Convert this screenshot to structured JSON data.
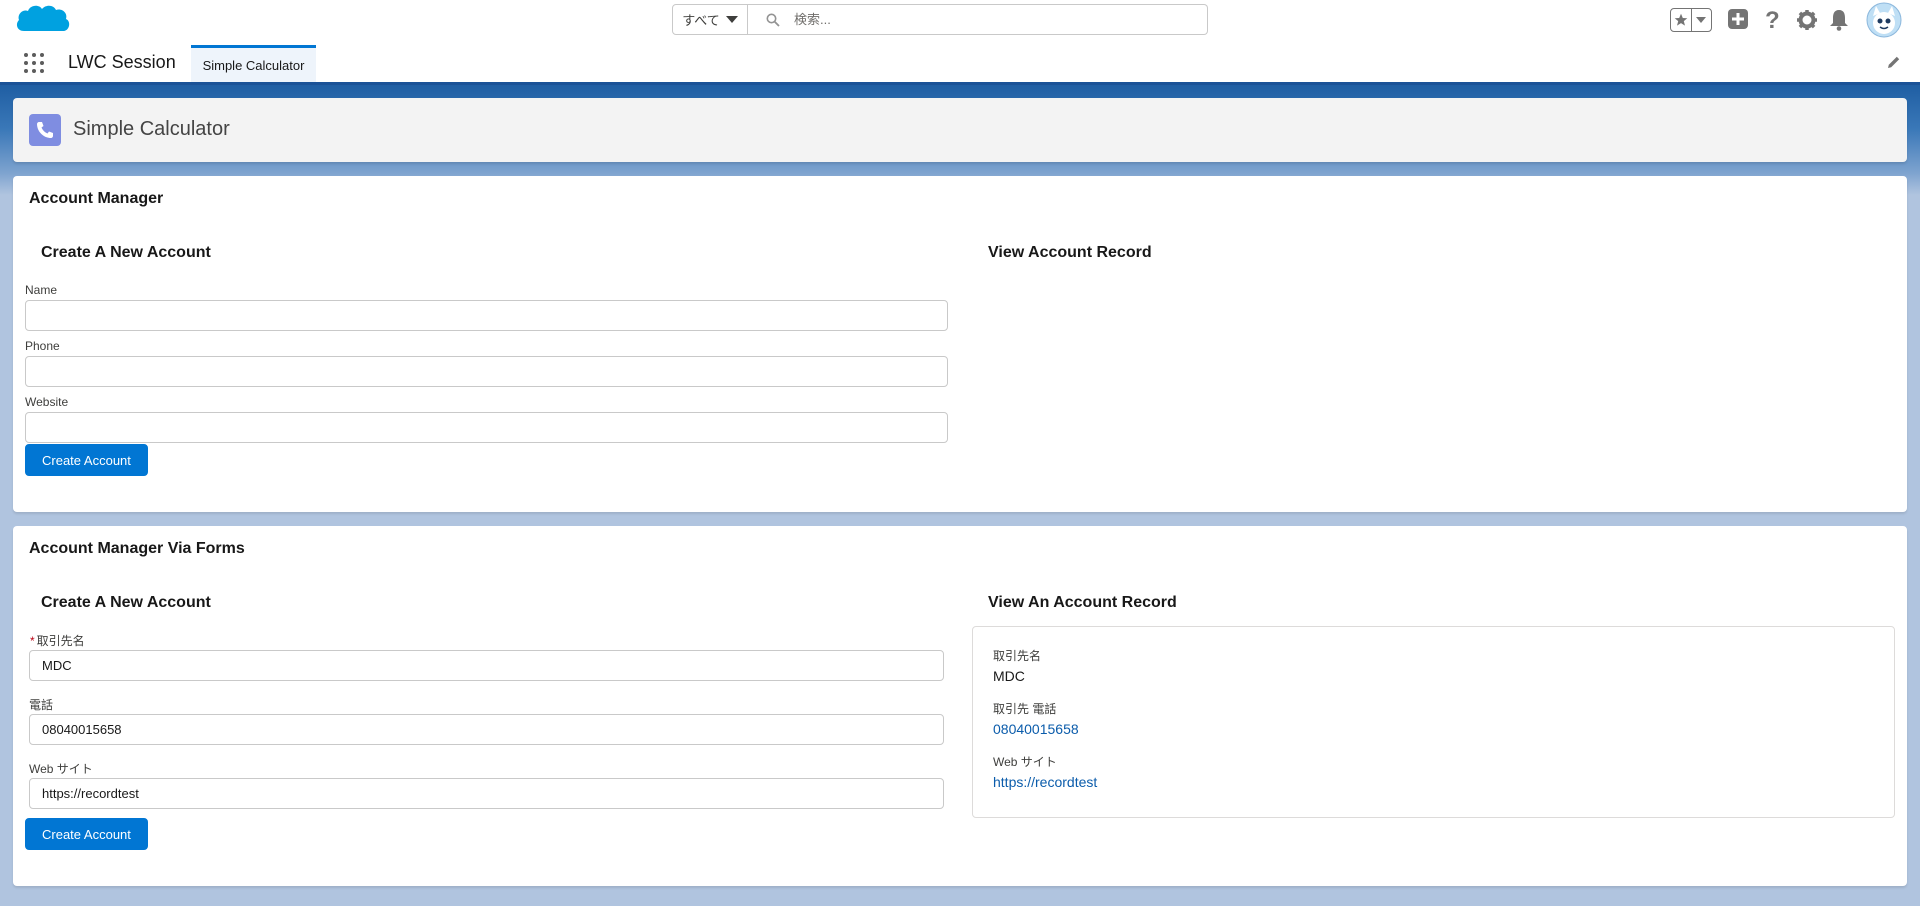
{
  "header": {
    "search_scope": "すべて",
    "search_placeholder": "検索..."
  },
  "nav": {
    "app_name": "LWC Session",
    "tabs": [
      {
        "label": "Simple Calculator"
      }
    ]
  },
  "page": {
    "title": "Simple Calculator"
  },
  "card1": {
    "title": "Account Manager",
    "create_section": {
      "title": "Create A New Account",
      "name_label": "Name",
      "name_value": "",
      "phone_label": "Phone",
      "phone_value": "",
      "website_label": "Website",
      "website_value": "",
      "button": "Create Account"
    },
    "view_section": {
      "title": "View Account Record"
    }
  },
  "card2": {
    "title": "Account Manager Via Forms",
    "create_section": {
      "title": "Create A New Account",
      "required_mark": "*",
      "name_label": "取引先名",
      "name_value": "MDC",
      "phone_label": "電話",
      "phone_value": "08040015658",
      "website_label": "Web サイト",
      "website_value": "https://recordtest",
      "button": "Create Account"
    },
    "view_section": {
      "title": "View An Account Record",
      "name_label": "取引先名",
      "name_value": "MDC",
      "phone_label": "取引先 電話",
      "phone_value": "08040015658",
      "website_label": "Web サイト",
      "website_value": "https://recordtest"
    }
  },
  "colors": {
    "brand": "#0176d3",
    "nav_accent": "#1b5297",
    "link": "#0b5cab"
  }
}
